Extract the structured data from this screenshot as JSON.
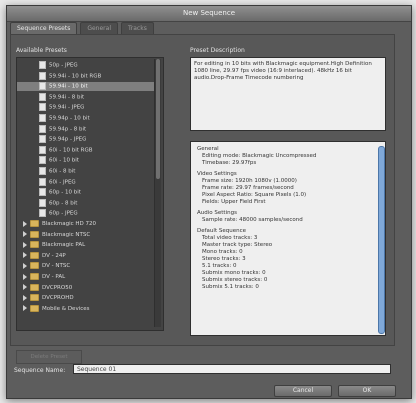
{
  "window": {
    "title": "New Sequence"
  },
  "tabs": [
    "Sequence Presets",
    "General",
    "Tracks"
  ],
  "presets_label": "Available Presets",
  "description_label": "Preset Description",
  "presets": [
    {
      "label": "50p - JPEG",
      "kind": "file",
      "level": 2
    },
    {
      "label": "59.94i - 10 bit RGB",
      "kind": "file",
      "level": 2
    },
    {
      "label": "59.94i - 10 bit",
      "kind": "file",
      "level": 2,
      "selected": true
    },
    {
      "label": "59.94i - 8 bit",
      "kind": "file",
      "level": 2
    },
    {
      "label": "59.94i - JPEG",
      "kind": "file",
      "level": 2
    },
    {
      "label": "59.94p - 10 bit",
      "kind": "file",
      "level": 2
    },
    {
      "label": "59.94p - 8 bit",
      "kind": "file",
      "level": 2
    },
    {
      "label": "59.94p - JPEG",
      "kind": "file",
      "level": 2
    },
    {
      "label": "60i - 10 bit RGB",
      "kind": "file",
      "level": 2
    },
    {
      "label": "60i - 10 bit",
      "kind": "file",
      "level": 2
    },
    {
      "label": "60i - 8 bit",
      "kind": "file",
      "level": 2
    },
    {
      "label": "60i - JPEG",
      "kind": "file",
      "level": 2
    },
    {
      "label": "60p - 10 bit",
      "kind": "file",
      "level": 2
    },
    {
      "label": "60p - 8 bit",
      "kind": "file",
      "level": 2
    },
    {
      "label": "60p - JPEG",
      "kind": "file",
      "level": 2
    },
    {
      "label": "Blackmagic HD 720",
      "kind": "folder",
      "level": 1
    },
    {
      "label": "Blackmagic NTSC",
      "kind": "folder",
      "level": 1
    },
    {
      "label": "Blackmagic PAL",
      "kind": "folder",
      "level": 1
    },
    {
      "label": "DV - 24P",
      "kind": "folder",
      "level": 0
    },
    {
      "label": "DV - NTSC",
      "kind": "folder",
      "level": 0
    },
    {
      "label": "DV - PAL",
      "kind": "folder",
      "level": 0
    },
    {
      "label": "DVCPRO50",
      "kind": "folder",
      "level": 0
    },
    {
      "label": "DVCPROHD",
      "kind": "folder",
      "level": 0
    },
    {
      "label": "Mobile & Devices",
      "kind": "folder",
      "level": 0
    }
  ],
  "description": "For editing in 10 bits with Blackmagic equipment.High Definition 1080 line, 29.97 fps video (16:9 interlaced). 48kHz 16 bit audio.Drop-Frame Timecode numbering",
  "details": [
    "General",
    "  Editing mode: Blackmagic Uncompressed",
    "  Timebase: 29.97fps",
    "",
    "Video Settings",
    "  Frame size: 1920h 1080v (1.0000)",
    "  Frame rate: 29.97 frames/second",
    "  Pixel Aspect Ratio: Square Pixels (1.0)",
    "  Fields: Upper Field First",
    "",
    "Audio Settings",
    "  Sample rate: 48000 samples/second",
    "",
    "Default Sequence",
    "  Total video tracks: 3",
    "  Master track type: Stereo",
    "  Mono tracks: 0",
    "  Stereo tracks: 3",
    "  5.1 tracks: 0",
    "  Submix mono tracks: 0",
    "  Submix stereo tracks: 0",
    "  Submix 5.1 tracks: 0"
  ],
  "delete_preset_label": "Delete Preset",
  "sequence_name_label": "Sequence Name:",
  "sequence_name_value": "Sequence 01",
  "cancel_label": "Cancel",
  "ok_label": "OK"
}
